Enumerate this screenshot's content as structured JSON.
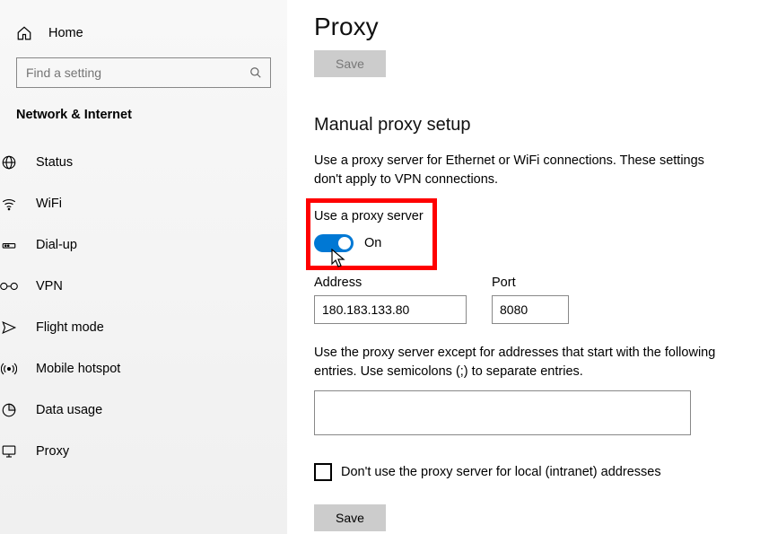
{
  "sidebar": {
    "home_label": "Home",
    "search_placeholder": "Find a setting",
    "category": "Network & Internet",
    "items": [
      {
        "label": "Status"
      },
      {
        "label": "WiFi"
      },
      {
        "label": "Dial-up"
      },
      {
        "label": "VPN"
      },
      {
        "label": "Flight mode"
      },
      {
        "label": "Mobile hotspot"
      },
      {
        "label": "Data usage"
      },
      {
        "label": "Proxy"
      }
    ]
  },
  "main": {
    "title": "Proxy",
    "save_top": "Save",
    "section_title": "Manual proxy setup",
    "section_desc": "Use a proxy server for Ethernet or WiFi connections. These settings don't apply to VPN connections.",
    "toggle_label": "Use a proxy server",
    "toggle_state": "On",
    "address_label": "Address",
    "address_value": "180.183.133.80",
    "port_label": "Port",
    "port_value": "8080",
    "exceptions_desc": "Use the proxy server except for addresses that start with the following entries. Use semicolons (;) to separate entries.",
    "exceptions_value": "",
    "bypass_local_label": "Don't use the proxy server for local (intranet) addresses",
    "save_bottom": "Save"
  }
}
